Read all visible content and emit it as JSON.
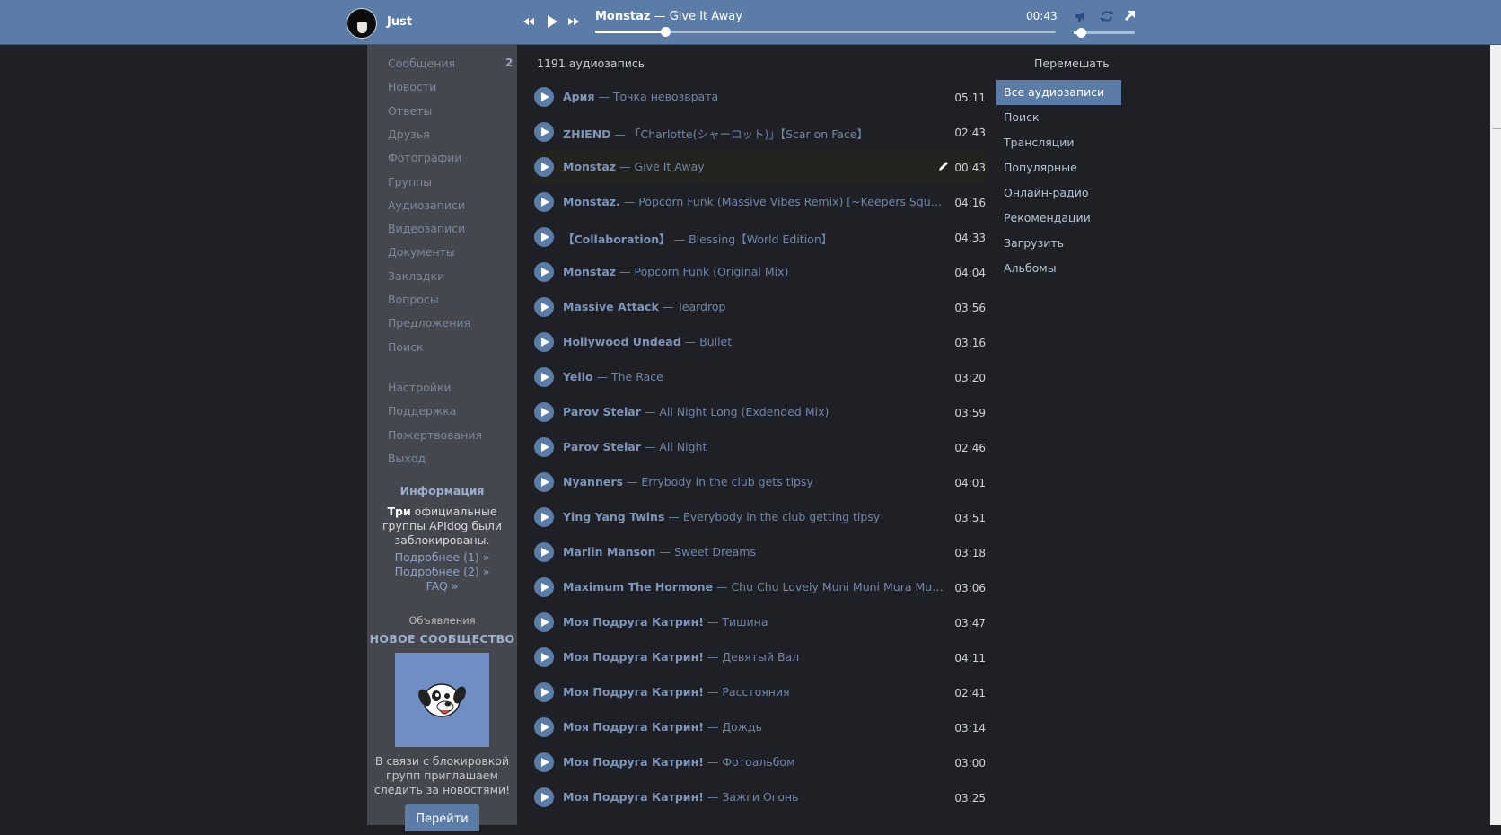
{
  "player": {
    "username": "Just",
    "now_artist": "Monstaz",
    "now_sep": " — ",
    "now_title": "Give It Away",
    "time": "00:43",
    "progress": 0.152,
    "volume": 0.12,
    "icons": [
      "rewind-icon",
      "play-icon",
      "fast-forward-icon",
      "broadcast-icon",
      "repeat-icon",
      "popout-icon"
    ]
  },
  "sidebar": {
    "items": [
      {
        "label": "Сообщения",
        "badge": "2"
      },
      {
        "label": "Новости"
      },
      {
        "label": "Ответы"
      },
      {
        "label": "Друзья"
      },
      {
        "label": "Фотографии"
      },
      {
        "label": "Группы"
      },
      {
        "label": "Аудиозаписи"
      },
      {
        "label": "Видеозаписи"
      },
      {
        "label": "Документы"
      },
      {
        "label": "Закладки"
      },
      {
        "label": "Вопросы"
      },
      {
        "label": "Предложения"
      },
      {
        "label": "Поиск"
      }
    ],
    "items2": [
      {
        "label": "Настройки"
      },
      {
        "label": "Поддержка"
      },
      {
        "label": "Пожертвования"
      },
      {
        "label": "Выход"
      }
    ],
    "info": {
      "title": "Информация",
      "text_strong": "Три",
      "text_rest": " официальные группы APIdog были заблокированы.",
      "link1": "Подробнее (1) »",
      "link2": "Подробнее (2) »",
      "link3": "FAQ »"
    },
    "ads": {
      "label": "Объявления",
      "title": "НОВОЕ СООБЩЕСТВО",
      "text": "В связи с блокировкой групп приглашаем следить за новостями!",
      "button": "Перейти"
    }
  },
  "audio": {
    "count_label": "1191 аудиозапись",
    "shuffle_label": "Перемешать",
    "tracks": [
      {
        "artist": "Ария",
        "title": "Точка невозврата",
        "duration": "05:11"
      },
      {
        "artist": "ZHIEND",
        "title": "「Charlotte(シャーロット)」【Scar on Face】",
        "duration": "02:43"
      },
      {
        "artist": "Monstaz",
        "title": "Give It Away",
        "duration": "00:43",
        "active": true
      },
      {
        "artist": "Monstaz.",
        "title": "Popcorn Funk (Massive Vibes Remix) [~Keepers Squad~]",
        "duration": "04:16"
      },
      {
        "artist": "【Collaboration】",
        "title": "Blessing【World Edition】",
        "duration": "04:33"
      },
      {
        "artist": "Monstaz",
        "title": "Popcorn Funk (Original Mix)",
        "duration": "04:04"
      },
      {
        "artist": "Massive Attack",
        "title": "Teardrop",
        "duration": "03:56"
      },
      {
        "artist": "Hollywood Undead",
        "title": "Bullet",
        "duration": "03:16"
      },
      {
        "artist": "Yello",
        "title": "The Race",
        "duration": "03:20"
      },
      {
        "artist": "Parov Stelar",
        "title": "All Night Long (Exdended Mix)",
        "duration": "03:59"
      },
      {
        "artist": "Parov Stelar",
        "title": "All Night",
        "duration": "02:46"
      },
      {
        "artist": "Nyanners",
        "title": "Errybody in the club gets tipsy",
        "duration": "04:01"
      },
      {
        "artist": "Ying Yang Twins",
        "title": "Everybody in the club getting tipsy",
        "duration": "03:51"
      },
      {
        "artist": "Marlin Manson",
        "title": "Sweet Dreams",
        "duration": "03:18"
      },
      {
        "artist": "Maximum The Hormone",
        "title": "Chu Chu Lovely Muni Muni Mura Mura Purin Purin Boron Nururu Rero Rero",
        "duration": "03:06"
      },
      {
        "artist": "Моя Подруга Катрин!",
        "title": "Тишина",
        "duration": "03:47"
      },
      {
        "artist": "Моя Подруга Катрин!",
        "title": "Девятый Вал",
        "duration": "04:11"
      },
      {
        "artist": "Моя Подруга Катрин!",
        "title": "Расстояния",
        "duration": "02:41"
      },
      {
        "artist": "Моя Подруга Катрин!",
        "title": "Дождь",
        "duration": "03:14"
      },
      {
        "artist": "Моя Подруга Катрин!",
        "title": "Фотоальбом",
        "duration": "03:00"
      },
      {
        "artist": "Моя Подруга Катрин!",
        "title": "Зажги Огонь",
        "duration": "03:25"
      }
    ]
  },
  "right_menu": {
    "items": [
      {
        "label": "Все аудиозаписи",
        "selected": true
      },
      {
        "label": "Поиск"
      },
      {
        "label": "Трансляции"
      },
      {
        "label": "Популярные"
      },
      {
        "label": "Онлайн-радио"
      },
      {
        "label": "Рекомендации"
      },
      {
        "label": "Загрузить"
      },
      {
        "label": "Альбомы"
      }
    ]
  },
  "colors": {
    "accent": "#5b7ca6",
    "background": "#1e2026",
    "sidebar": "#45474f",
    "link": "#7d95b9"
  }
}
